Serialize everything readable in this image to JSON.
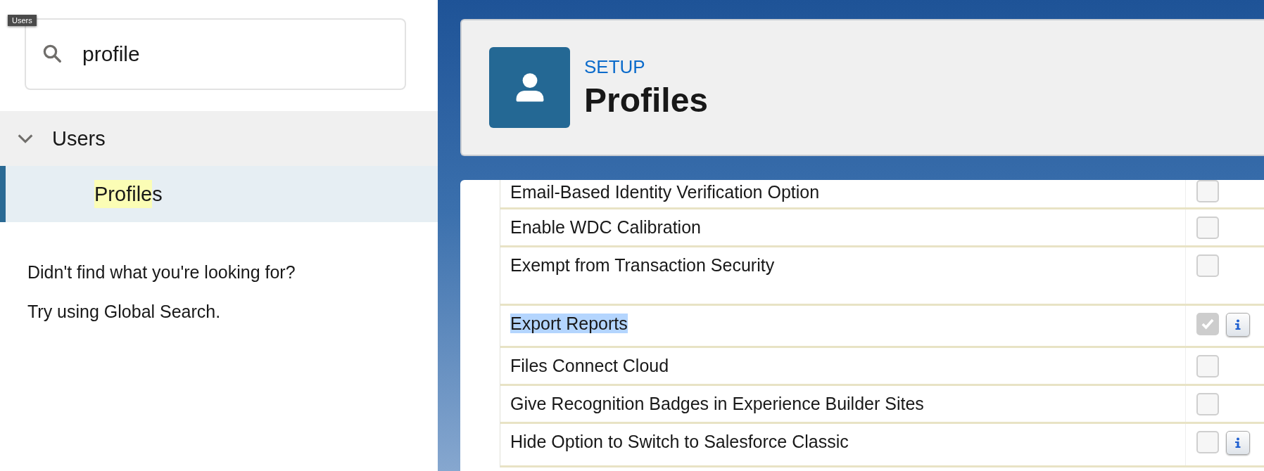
{
  "tooltip": "Users",
  "search": {
    "value": "profile"
  },
  "tree": [
    {
      "label": "Users",
      "expanded": true,
      "children": [
        {
          "label_match": "Profile",
          "label_rest": "s",
          "selected": true
        }
      ]
    }
  ],
  "help": [
    "Didn't find what you're looking for?",
    "Try using Global Search."
  ],
  "header": {
    "eyebrow": "SETUP",
    "title": "Profiles"
  },
  "permissions": [
    {
      "label": "Email-Based Identity Verification Option",
      "checked": false,
      "info": false,
      "highlighted": false
    },
    {
      "label": "Enable WDC Calibration",
      "checked": false,
      "info": false,
      "highlighted": false
    },
    {
      "label": "Exempt from Transaction Security",
      "checked": false,
      "info": false,
      "highlighted": false
    },
    {
      "label": "Export Reports",
      "checked": true,
      "info": true,
      "highlighted": true
    },
    {
      "label": "Files Connect Cloud",
      "checked": false,
      "info": false,
      "highlighted": false
    },
    {
      "label": "Give Recognition Badges in Experience Builder Sites",
      "checked": false,
      "info": false,
      "highlighted": false
    },
    {
      "label": "Hide Option to Switch to Salesforce Classic",
      "checked": false,
      "info": true,
      "highlighted": false
    }
  ]
}
